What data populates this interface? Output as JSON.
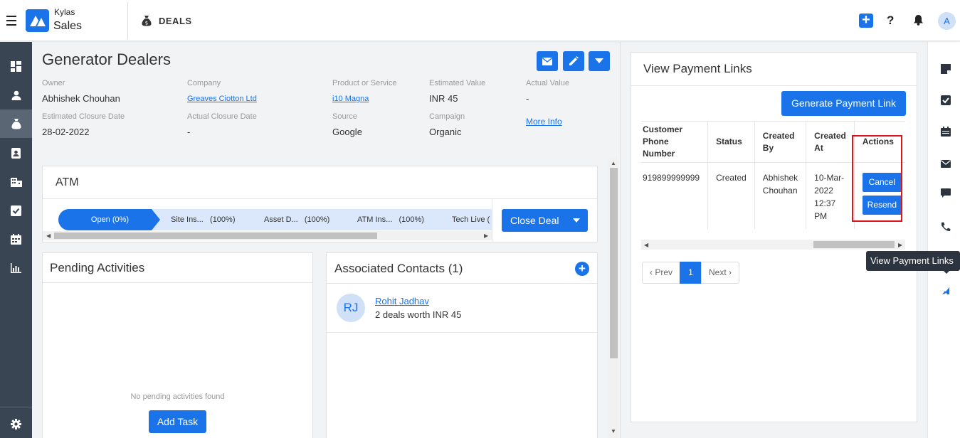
{
  "app": {
    "brand_top": "Kylas",
    "brand_bottom": "Sales",
    "module": "DEALS"
  },
  "deal": {
    "title": "Generator Dealers",
    "fields": {
      "owner_label": "Owner",
      "owner": "Abhishek Chouhan",
      "company_label": "Company",
      "company": "Greaves Ciotton Ltd",
      "product_label": "Product or Service",
      "product": "i10 Magna",
      "est_value_label": "Estimated Value",
      "est_value": "INR 45",
      "actual_value_label": "Actual Value",
      "actual_value": "-",
      "est_close_label": "Estimated Closure Date",
      "est_close": "28-02-2022",
      "actual_close_label": "Actual Closure Date",
      "actual_close": "-",
      "source_label": "Source",
      "source": "Google",
      "campaign_label": "Campaign",
      "campaign": "Organic",
      "more_info": "More Info"
    }
  },
  "pipeline": {
    "title": "ATM",
    "stages": [
      {
        "name": "Open (0%)"
      },
      {
        "name": "Site Ins...",
        "pct": "(100%)"
      },
      {
        "name": "Asset D...",
        "pct": "(100%)"
      },
      {
        "name": "ATM Ins...",
        "pct": "(100%)"
      },
      {
        "name": "Tech Live (",
        "pct": ""
      }
    ],
    "close_deal": "Close Deal"
  },
  "pending": {
    "title": "Pending Activities",
    "empty": "No pending activities found",
    "add_task": "Add Task"
  },
  "contacts": {
    "title": "Associated Contacts (1)",
    "items": [
      {
        "initials": "RJ",
        "name": "Rohit Jadhav",
        "sub": "2 deals worth INR 45"
      }
    ]
  },
  "payment_links": {
    "title": "View Payment Links",
    "generate": "Generate Payment Link",
    "headers": {
      "phone_1": "Customer",
      "phone_2": "Phone Number",
      "status": "Status",
      "created_by_1": "Created",
      "created_by_2": "By",
      "created_at_1": "Created",
      "created_at_2": "At",
      "actions": "Actions"
    },
    "row": {
      "phone": "919899999999",
      "status": "Created",
      "created_by_1": "Abhishek",
      "created_by_2": "Chouhan",
      "created_at_1": "10-Mar-",
      "created_at_2": "2022",
      "created_at_3": "12:37",
      "created_at_4": "PM",
      "cancel": "Cancel",
      "resend": "Resend"
    },
    "pager": {
      "prev": "‹ Prev",
      "page": "1",
      "next": "Next ›"
    }
  },
  "tooltip": "View Payment Links",
  "colors": {
    "accent": "#1a73e8",
    "nav_bg": "#3a4553",
    "highlight": "#e0141b"
  }
}
